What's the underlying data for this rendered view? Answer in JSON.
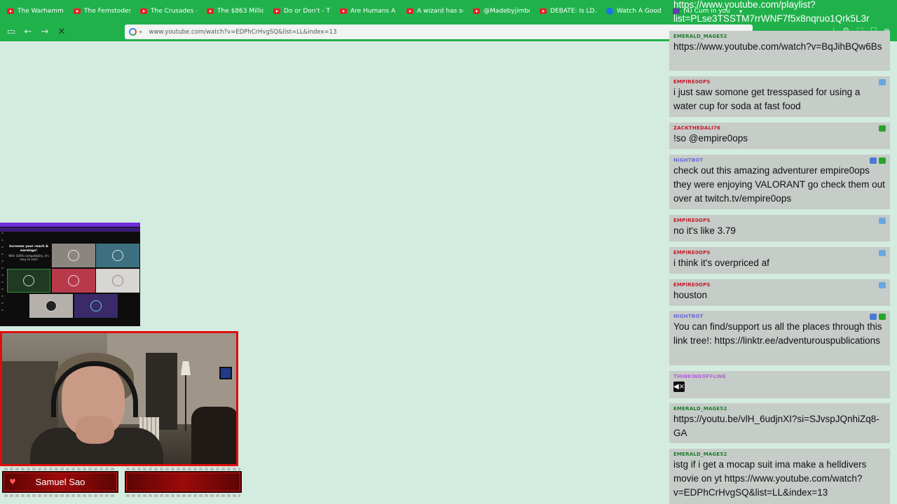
{
  "browser": {
    "tabs": [
      {
        "label": "The Warhamme",
        "icon": "youtube-icon"
      },
      {
        "label": "The Femstodes",
        "icon": "youtube-icon"
      },
      {
        "label": "The Crusades -",
        "icon": "youtube-icon"
      },
      {
        "label": "The $863 Millio",
        "icon": "youtube-icon"
      },
      {
        "label": "Do or Don't - Ti",
        "icon": "youtube-icon"
      },
      {
        "label": "Are Humans A S",
        "icon": "youtube-icon"
      },
      {
        "label": "A wizard has se",
        "icon": "youtube-icon"
      },
      {
        "label": "@Madebyjimbo",
        "icon": "youtube-icon"
      },
      {
        "label": "DEBATE: Is LD.S",
        "icon": "youtube-icon"
      },
      {
        "label": "Watch A Good I",
        "icon": "globe-icon"
      },
      {
        "label": "(4) Cum in your",
        "icon": "twitch-icon"
      }
    ],
    "url": "www.youtube.com/watch?v=EDPhCrHvgSQ&list=LL&index=13"
  },
  "webcam": {
    "name_left": "Samuel Sao",
    "name_right": ""
  },
  "share_thumb": {
    "promo_title": "Increase your reach & earnings!",
    "promo_text": "With 100% compatibility, it's easy to start"
  },
  "chat": {
    "messages": [
      {
        "user": "",
        "color": "#1e7a2e",
        "text": "https://www.youtube.com/playlist?list=PLse3TSSTM7rrWNF7f5x8nqruo1Qrk5L3r",
        "badges": []
      },
      {
        "user": "EMERALD_MAGE52",
        "color": "#1f7a2f",
        "text": "https://www.youtube.com/watch?v=BqJihBQw6Bs",
        "badges": []
      },
      {
        "user": "EMPIRE0OPS",
        "color": "#c8192a",
        "text": "i just saw somone get tresspased for using a water cup for soda at fast food",
        "badges": [
          "sub"
        ]
      },
      {
        "user": "ZACKTHEDALI76",
        "color": "#c8192a",
        "text": "!so @empire0ops",
        "badges": [
          "mod"
        ]
      },
      {
        "user": "NIGHTBOT",
        "color": "#6a6ad8",
        "text": "check out this amazing adventurer empire0ops they were enjoying VALORANT go check them out over at twitch.tv/empire0ops",
        "badges": [
          "bot",
          "mod"
        ]
      },
      {
        "user": "EMPIRE0OPS",
        "color": "#c8192a",
        "text": "no it's like 3.79",
        "badges": [
          "sub"
        ]
      },
      {
        "user": "EMPIRE0OPS",
        "color": "#c8192a",
        "text": "i think it's overpriced af",
        "badges": [
          "sub"
        ]
      },
      {
        "user": "EMPIRE0OPS",
        "color": "#c8192a",
        "text": "houston",
        "badges": [
          "sub"
        ]
      },
      {
        "user": "NIGHTBOT",
        "color": "#6a6ad8",
        "text": "You can find/support us all the places through this link tree!: https://linktr.ee/adventurouspublications",
        "badges": [
          "bot",
          "mod"
        ]
      },
      {
        "user": "THINKINGOFFLINE",
        "color": "#b061d6",
        "text": "",
        "badges": []
      },
      {
        "user": "EMERALD_MAGE52",
        "color": "#1f7a2f",
        "text": "https://youtu.be/vlH_6udjnXI?si=SJvspJQnhiZq8-GA",
        "badges": []
      },
      {
        "user": "EMERALD_MAGE52",
        "color": "#1f7a2f",
        "text": "istg if i get a mocap suit ima make a helldivers movie on yt https://www.youtube.com/watch?v=EDPhCrHvgSQ&list=LL&index=13",
        "badges": []
      }
    ]
  }
}
